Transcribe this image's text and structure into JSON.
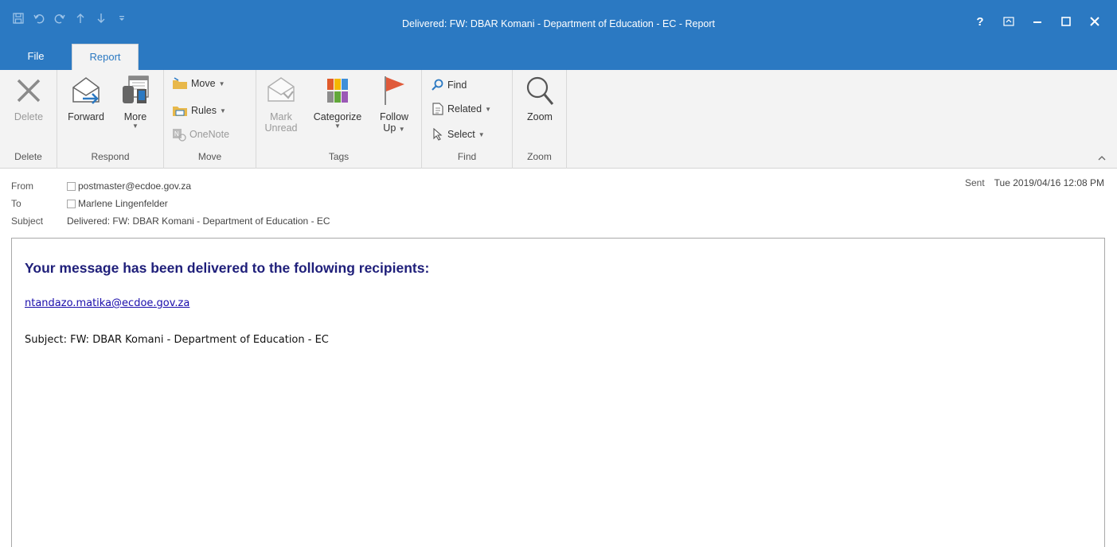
{
  "window": {
    "title": "Delivered: FW: DBAR Komani - Department of Education - EC - Report",
    "help_label": "?",
    "accent": "#2b79c2"
  },
  "tabs": [
    {
      "label": "File"
    },
    {
      "label": "Report"
    }
  ],
  "ribbon": {
    "delete": {
      "button": "Delete",
      "group": "Delete"
    },
    "respond": {
      "forward": "Forward",
      "more": "More",
      "group": "Respond"
    },
    "move": {
      "move": "Move",
      "rules": "Rules",
      "onenote": "OneNote",
      "group": "Move"
    },
    "tags": {
      "mark_line1": "Mark",
      "mark_line2": "Unread",
      "categorize": "Categorize",
      "follow_line1": "Follow",
      "follow_line2": "Up",
      "group": "Tags"
    },
    "find": {
      "find": "Find",
      "related": "Related",
      "select": "Select",
      "group": "Find"
    },
    "zoom": {
      "button": "Zoom",
      "group": "Zoom"
    }
  },
  "header": {
    "from_label": "From",
    "from_value": "postmaster@ecdoe.gov.za",
    "to_label": "To",
    "to_value": "Marlene Lingenfelder",
    "subject_label": "Subject",
    "subject_value": "Delivered: FW: DBAR Komani - Department of Education - EC",
    "sent_label": "Sent",
    "sent_value": "Tue 2019/04/16 12:08 PM"
  },
  "message": {
    "heading": "Your message has been delivered to the following recipients:",
    "recipient": "ntandazo.matika@ecdoe.gov.za",
    "subject_line": "Subject: FW: DBAR Komani - Department of Education - EC"
  }
}
